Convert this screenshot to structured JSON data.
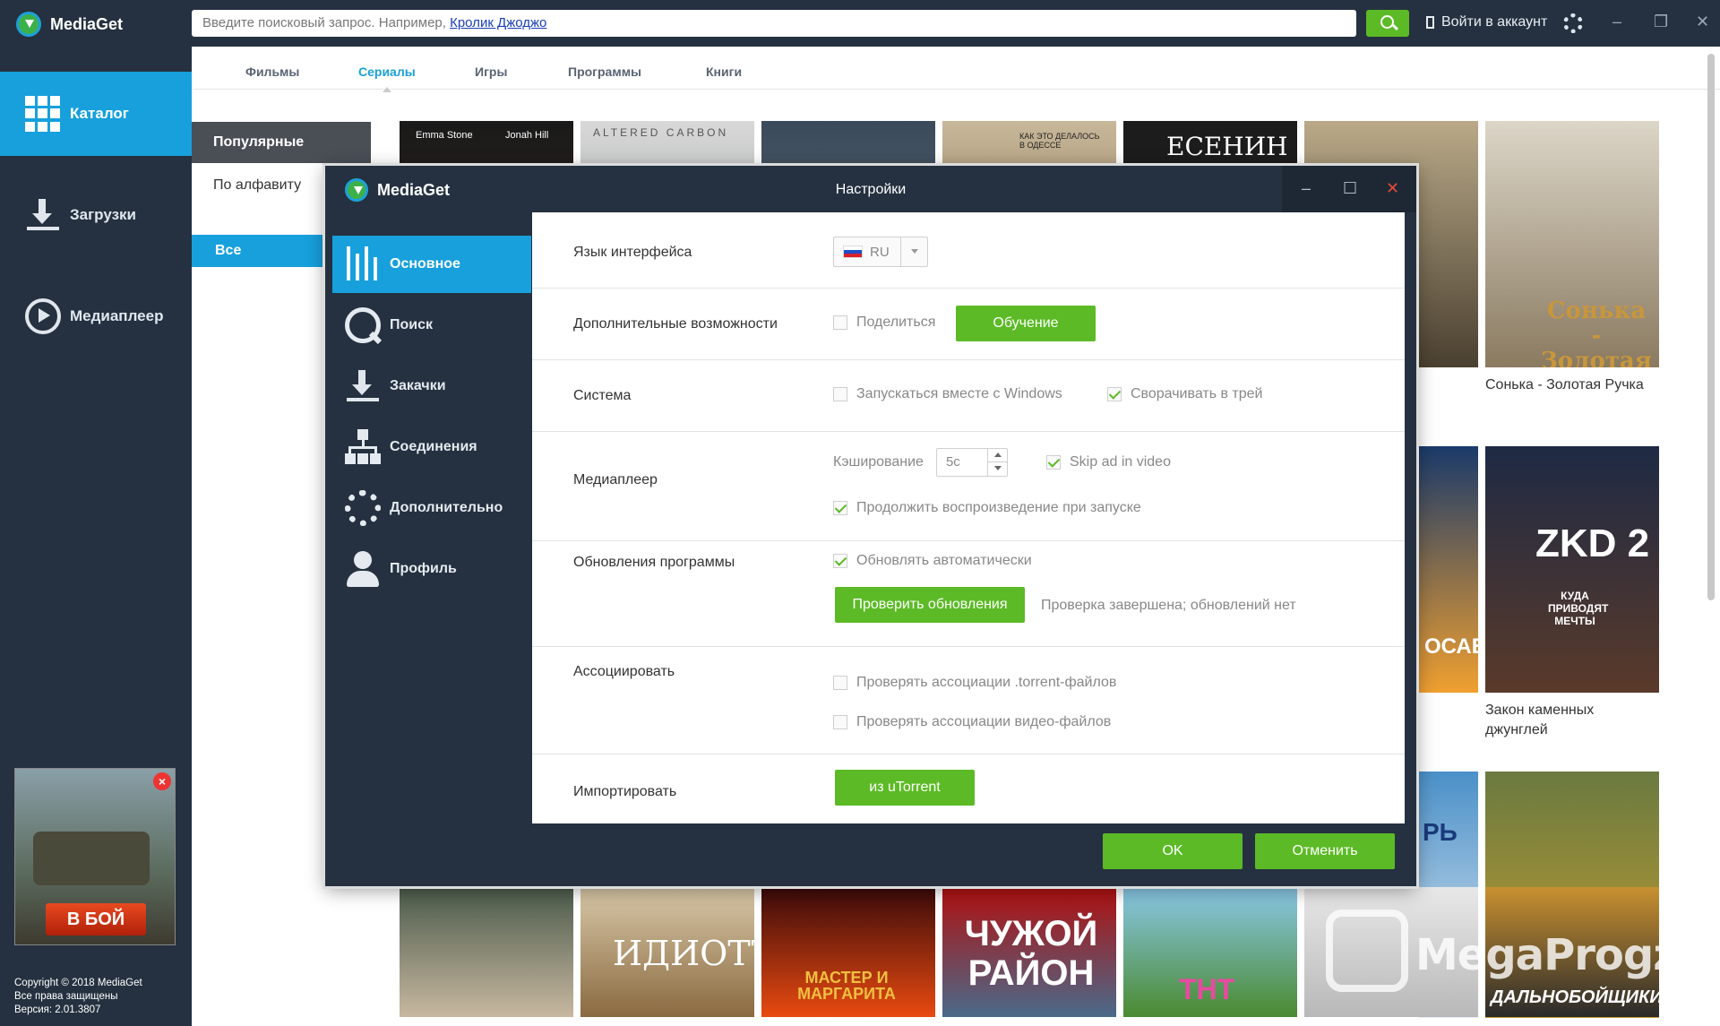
{
  "app": {
    "name": "MediaGet"
  },
  "sidebar": {
    "items": [
      {
        "label": "Каталог",
        "icon": "grid-icon"
      },
      {
        "label": "Загрузки",
        "icon": "download-icon"
      },
      {
        "label": "Медиаплеер",
        "icon": "play-icon"
      }
    ],
    "ad": {
      "button": "В БОЙ"
    },
    "copyright": [
      "Copyright © 2018 MediaGet",
      "Все права защищены",
      "Версия: 2.01.3807"
    ]
  },
  "topbar": {
    "search_prefix": "Введите поисковый запрос. Например, ",
    "search_example": "Кролик Джоджо",
    "account": "Войти в аккаунт"
  },
  "tabs": [
    "Фильмы",
    "Сериалы",
    "Игры",
    "Программы",
    "Книги"
  ],
  "submenu": [
    "Популярные",
    "По алфавиту",
    "Все"
  ],
  "posters": {
    "captions": [
      "Сонька - Золотая Ручка",
      "Закон каменных",
      "джунглей"
    ],
    "labels": {
      "emma": "Emma Stone",
      "jonah": "Jonah Hill",
      "altered": "ALTERED CARBON",
      "odessa": "КАК ЭТО ДЕЛАЛОСЬ В ОДЕССЕ",
      "esenin": "ЕСЕНИН",
      "sonka": "Сонька - Золотая Ручка",
      "zkd": "ZKD 2",
      "zkd_sub": "КУДА ПРИВОДЯТ МЕЧТЫ",
      "idiot": "ИДИОТЪ",
      "master": "МАСТЕР И МАРГАРИТА",
      "chuzhoi": "ЧУЖОЙ РАЙОН",
      "tnt": "ТНТ",
      "dalno": "ДАЛЬНОБОЙЩИКИ",
      "pb": "РЬ",
      "ocae": "ОСАЕ"
    },
    "watermark": "MegaProgz"
  },
  "dialog": {
    "logo": "MediaGet",
    "title": "Настройки",
    "nav": [
      "Основное",
      "Поиск",
      "Закачки",
      "Соединения",
      "Дополнительно",
      "Профиль"
    ],
    "rows": {
      "lang_label": "Язык интерфейса",
      "lang_value": "RU",
      "extra_label": "Дополнительные возможности",
      "share": "Поделиться",
      "tutorial": "Обучение",
      "system_label": "Система",
      "autostart": "Запускаться вместе с Windows",
      "tray": "Сворачивать в трей",
      "player_label": "Медиаплеер",
      "cache_label": "Кэширование",
      "cache_value": "5с",
      "skip_ad": "Skip ad in video",
      "resume": "Продолжить воспроизведение при запуске",
      "update_label": "Обновления программы",
      "auto_update": "Обновлять автоматически",
      "check_updates": "Проверить обновления",
      "update_status": "Проверка завершена; обновлений нет",
      "assoc_label": "Ассоциировать",
      "assoc_torrent": "Проверять ассоциации .torrent-файлов",
      "assoc_video": "Проверять ассоциации видео-файлов",
      "import_label": "Импортировать",
      "import_btn": "из uTorrent"
    },
    "ok": "OK",
    "cancel": "Отменить"
  }
}
